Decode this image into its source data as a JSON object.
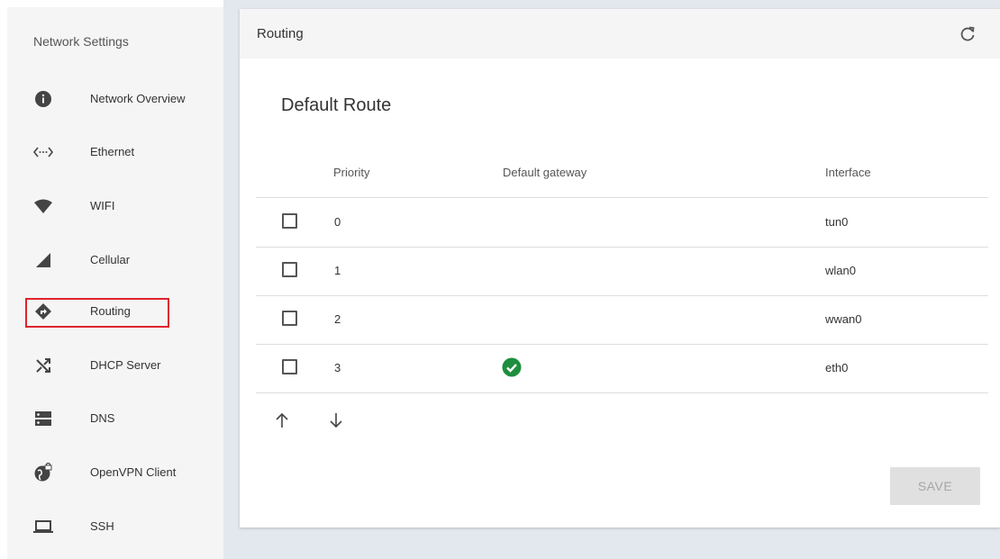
{
  "sidebar": {
    "title": "Network Settings",
    "items": [
      {
        "label": "Network Overview",
        "icon": "info-icon"
      },
      {
        "label": "Ethernet",
        "icon": "ethernet-icon"
      },
      {
        "label": "WIFI",
        "icon": "wifi-icon"
      },
      {
        "label": "Cellular",
        "icon": "cellular-icon"
      },
      {
        "label": "Routing",
        "icon": "routing-icon"
      },
      {
        "label": "DHCP Server",
        "icon": "shuffle-icon"
      },
      {
        "label": "DNS",
        "icon": "dns-icon"
      },
      {
        "label": "OpenVPN Client",
        "icon": "vpn-globe-icon"
      },
      {
        "label": "SSH",
        "icon": "laptop-icon"
      }
    ],
    "highlighted_item": "Routing",
    "highlight_color": "#e0232e"
  },
  "header": {
    "title": "Routing",
    "refresh_icon": "refresh-icon"
  },
  "section": {
    "title": "Default Route"
  },
  "table": {
    "columns": {
      "priority": "Priority",
      "gateway": "Default gateway",
      "interface": "Interface"
    },
    "rows": [
      {
        "priority": "0",
        "gateway_default": false,
        "interface": "tun0"
      },
      {
        "priority": "1",
        "gateway_default": false,
        "interface": "wlan0"
      },
      {
        "priority": "2",
        "gateway_default": false,
        "interface": "wwan0"
      },
      {
        "priority": "3",
        "gateway_default": true,
        "interface": "eth0"
      }
    ],
    "check_color": "#1e8e3e"
  },
  "actions": {
    "move_up_icon": "arrow-up-icon",
    "move_down_icon": "arrow-down-icon",
    "save_label": "SAVE"
  }
}
